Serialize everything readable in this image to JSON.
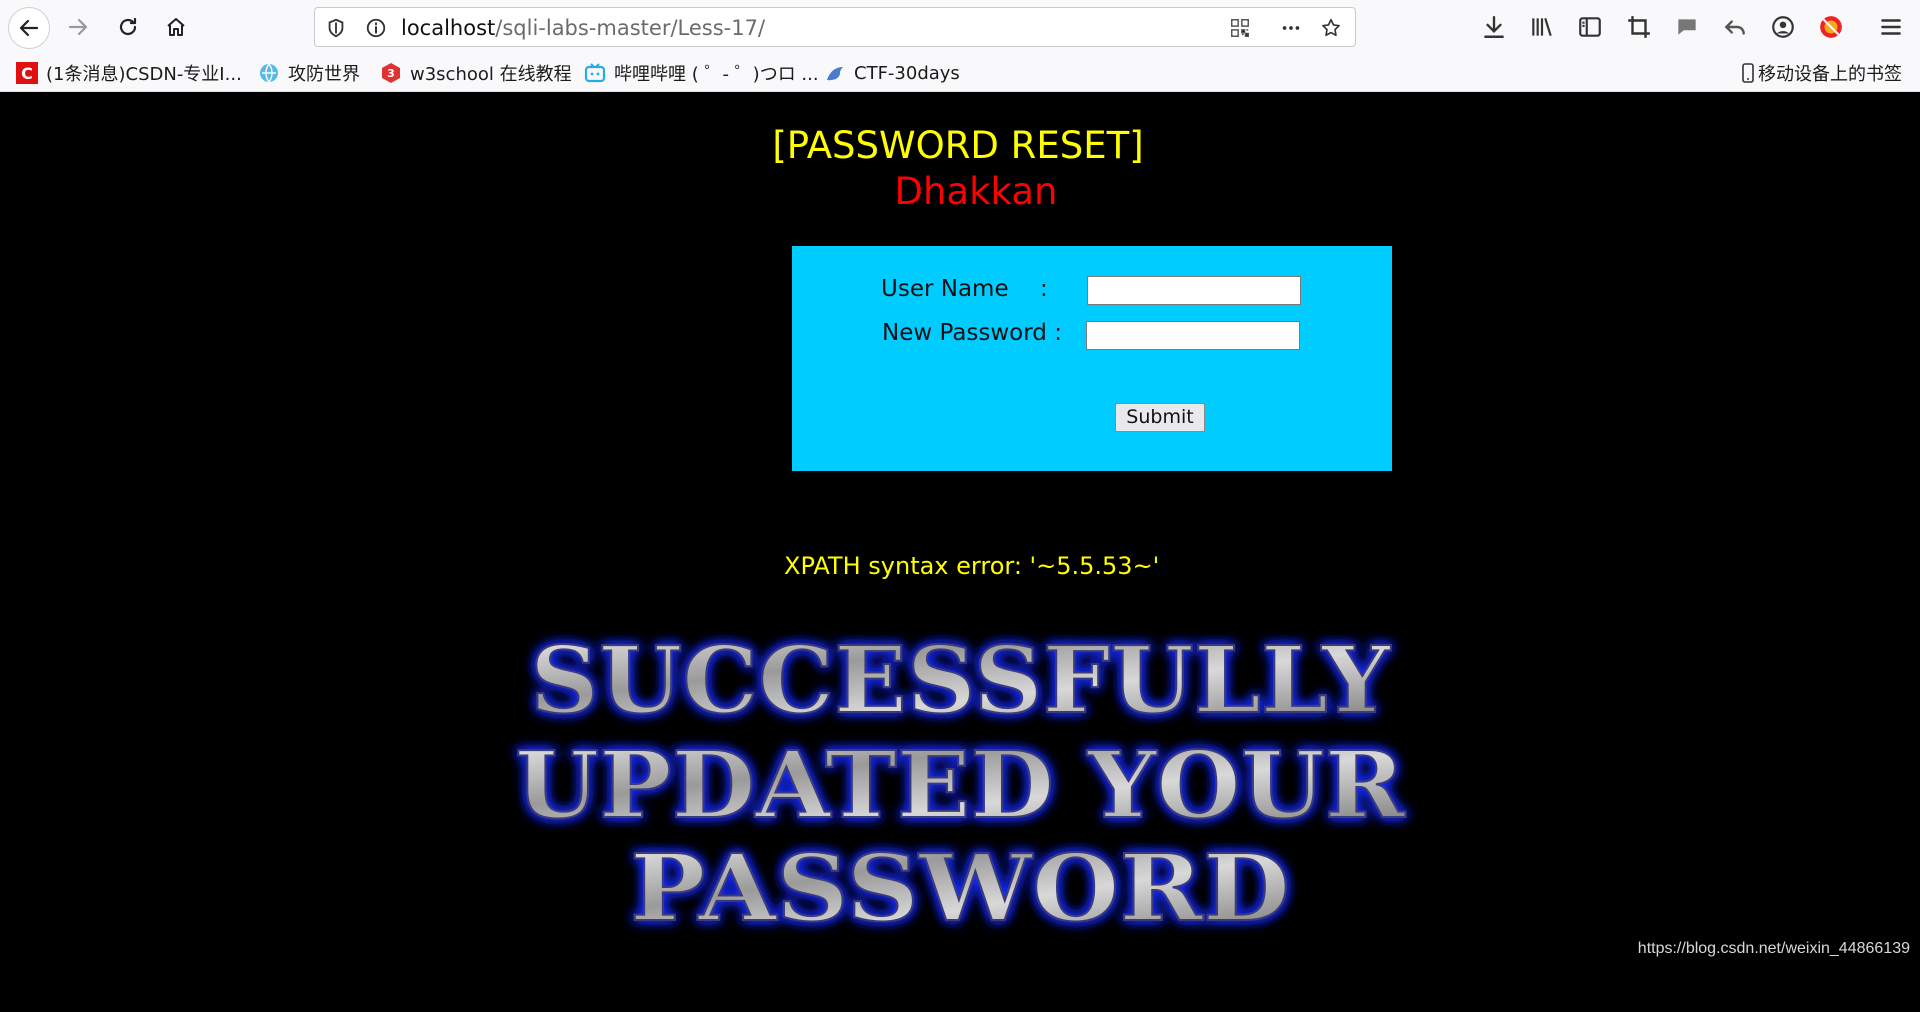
{
  "browser": {
    "url_host": "localhost",
    "url_path": "/sqli-labs-master/Less-17/",
    "bookmarks": [
      {
        "label": "(1条消息)CSDN-专业I...",
        "icon": "csdn-icon"
      },
      {
        "label": "攻防世界",
        "icon": "globe-icon"
      },
      {
        "label": "w3school 在线教程",
        "icon": "w3school-icon"
      },
      {
        "label": "哔哩哔哩 ( ゜- ゜)つロ ...",
        "icon": "bilibili-icon"
      },
      {
        "label": "CTF-30days",
        "icon": "dolphin-icon"
      }
    ],
    "mobile_bookmarks": "移动设备上的书签"
  },
  "page": {
    "heading": "[PASSWORD RESET]",
    "subheading": "Dhakkan",
    "form": {
      "username_label": "User Name",
      "username_colon": ":",
      "password_label": "New Password :",
      "username_value": "",
      "password_value": "",
      "submit_label": "Submit"
    },
    "error": "XPATH syntax error: '~5.5.53~'",
    "success_lines": [
      "SUCCESSFULLY",
      "UPDATED YOUR",
      "PASSWORD"
    ]
  },
  "watermark": "https://blog.csdn.net/weixin_44866139",
  "colors": {
    "background": "#000000",
    "heading": "#ffff00",
    "subheading": "#ff0000",
    "form_bg": "#00ccff",
    "error": "#ffff00",
    "success_glow": "#1a2cff"
  }
}
